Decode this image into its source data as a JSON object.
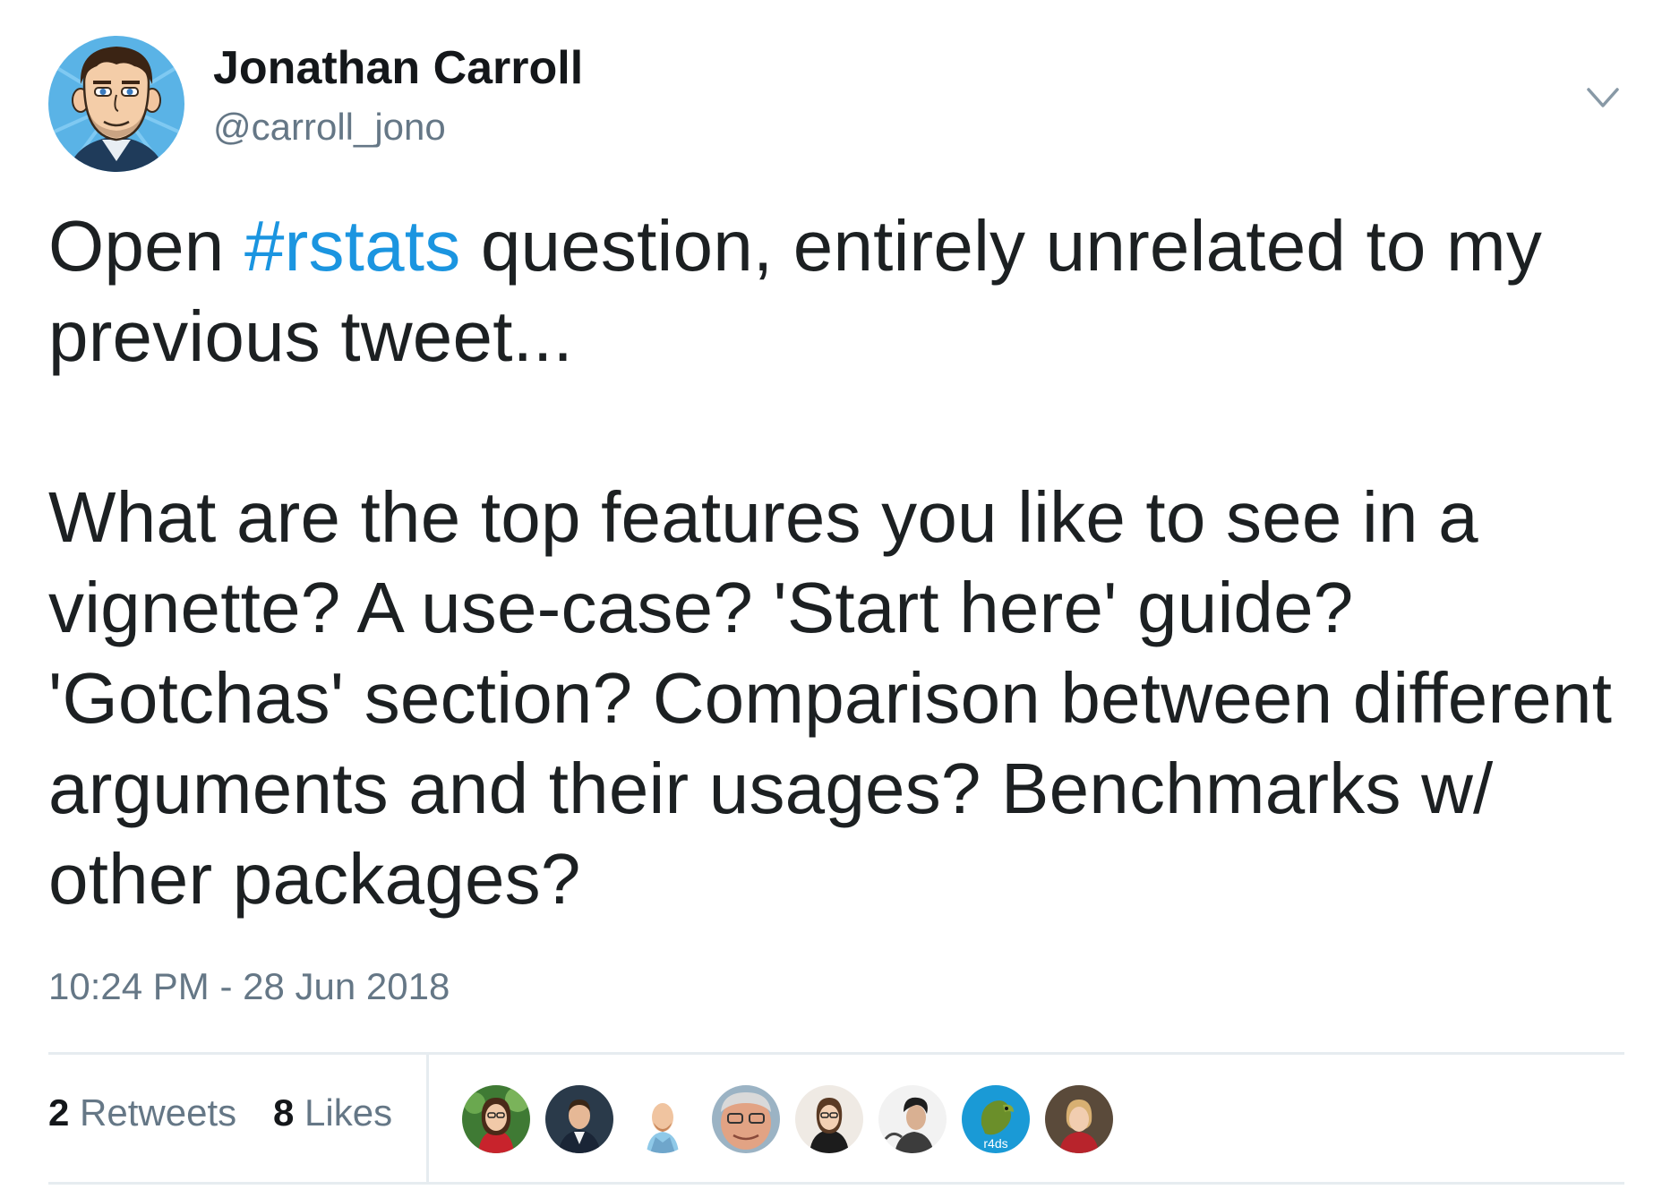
{
  "author": {
    "name": "Jonathan Carroll",
    "handle": "@carroll_jono",
    "avatar_icon": "cartoon-avatar-icon"
  },
  "menu": {
    "icon": "chevron-down-icon"
  },
  "tweet": {
    "text_before_hashtag": "Open ",
    "hashtag": "#rstats",
    "text_after_hashtag": " question, entirely unrelated to my previous tweet...\n\nWhat are the top features you like to see in a vignette? A use-case? 'Start here' guide? 'Gotchas' section? Comparison between different arguments and their usages? Benchmarks w/ other packages?",
    "timestamp": "10:24 PM - 28 Jun 2018"
  },
  "stats": {
    "retweets_count": "2",
    "retweets_label": "Retweets",
    "likes_count": "8",
    "likes_label": "Likes"
  },
  "likers": [
    {
      "icon": "user-avatar-icon"
    },
    {
      "icon": "user-avatar-icon"
    },
    {
      "icon": "user-avatar-icon"
    },
    {
      "icon": "user-avatar-icon"
    },
    {
      "icon": "user-avatar-icon"
    },
    {
      "icon": "user-avatar-icon"
    },
    {
      "icon": "r4ds-logo-icon",
      "logo_text": "r4ds"
    },
    {
      "icon": "user-avatar-icon"
    }
  ],
  "colors": {
    "hashtag": "#1b95e0",
    "secondary_text": "#657786",
    "primary_text": "#14171a",
    "divider": "#e6ecf0"
  }
}
